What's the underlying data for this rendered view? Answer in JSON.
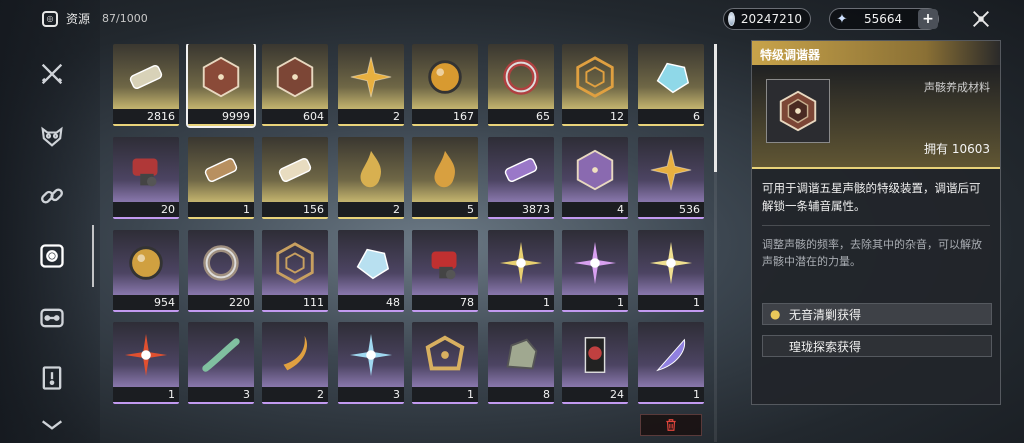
{
  "header": {
    "resource_label": "资源",
    "resource_count": "87/1000",
    "currency1": "20247210",
    "currency2": "55664",
    "add_label": "+"
  },
  "nav": [
    "sword-icon",
    "echo-mask-icon",
    "link-icon",
    "resource-icon",
    "device-icon",
    "quest-icon",
    "chevron-icon"
  ],
  "items": [
    {
      "qty": "2816",
      "rarity": "gold",
      "icon": "canister-icon",
      "color": "#d8d2b8"
    },
    {
      "qty": "9999",
      "rarity": "gold",
      "icon": "tuner-core-icon",
      "color": "#8a4a38"
    },
    {
      "qty": "604",
      "rarity": "gold",
      "icon": "tuner-core-icon",
      "color": "#7c4636"
    },
    {
      "qty": "2",
      "rarity": "gold",
      "icon": "golden-star-icon",
      "color": "#e8b040"
    },
    {
      "qty": "167",
      "rarity": "gold",
      "icon": "golden-orb-icon",
      "color": "#d89a30"
    },
    {
      "qty": "65",
      "rarity": "gold",
      "icon": "ring-icon",
      "color": "#b04040"
    },
    {
      "qty": "12",
      "rarity": "gold",
      "icon": "golden-web-icon",
      "color": "#e0a040"
    },
    {
      "qty": "6",
      "rarity": "gold",
      "icon": "crystal-shell-icon",
      "color": "#8fd8e8"
    },
    {
      "qty": "20",
      "rarity": "purple",
      "icon": "mech-part-icon",
      "color": "#b03838"
    },
    {
      "qty": "1",
      "rarity": "gold",
      "icon": "scroll-canister-icon",
      "color": "#b89060"
    },
    {
      "qty": "156",
      "rarity": "gold",
      "icon": "bullet-icon",
      "color": "#e8dcc0"
    },
    {
      "qty": "2",
      "rarity": "gold",
      "icon": "wave-shard-icon",
      "color": "#d8b050"
    },
    {
      "qty": "5",
      "rarity": "gold",
      "icon": "flame-shard-icon",
      "color": "#d8a040"
    },
    {
      "qty": "3873",
      "rarity": "purple",
      "icon": "purple-canister-icon",
      "color": "#9a78c8"
    },
    {
      "qty": "4",
      "rarity": "purple",
      "icon": "purple-core-icon",
      "color": "#8a6ab0"
    },
    {
      "qty": "536",
      "rarity": "purple",
      "icon": "golden-star-icon",
      "color": "#e8b040"
    },
    {
      "qty": "954",
      "rarity": "purple",
      "icon": "dark-orb-icon",
      "color": "#d0a040"
    },
    {
      "qty": "220",
      "rarity": "purple",
      "icon": "ring-icon",
      "color": "#a09080"
    },
    {
      "qty": "111",
      "rarity": "purple",
      "icon": "golden-web-icon",
      "color": "#c8a060"
    },
    {
      "qty": "48",
      "rarity": "purple",
      "icon": "crystal-icon",
      "color": "#b8e0f0"
    },
    {
      "qty": "78",
      "rarity": "purple",
      "icon": "mech-part-icon",
      "color": "#c03030"
    },
    {
      "qty": "1",
      "rarity": "purple",
      "icon": "spark-icon",
      "color": "#e8d070"
    },
    {
      "qty": "1",
      "rarity": "purple",
      "icon": "violet-spark-icon",
      "color": "#d8a0f0"
    },
    {
      "qty": "1",
      "rarity": "purple",
      "icon": "spark-icon",
      "color": "#f0e090"
    },
    {
      "qty": "1",
      "rarity": "purple",
      "icon": "fire-spark-icon",
      "color": "#e05030"
    },
    {
      "qty": "3",
      "rarity": "purple",
      "icon": "vine-icon",
      "color": "#80c0a0"
    },
    {
      "qty": "2",
      "rarity": "purple",
      "icon": "crescent-icon",
      "color": "#e0a040"
    },
    {
      "qty": "3",
      "rarity": "purple",
      "icon": "ice-spark-icon",
      "color": "#a0d8f0"
    },
    {
      "qty": "1",
      "rarity": "purple",
      "icon": "amber-frame-icon",
      "color": "#d8b060"
    },
    {
      "qty": "8",
      "rarity": "purple",
      "icon": "mossy-stone-icon",
      "color": "#a0a890"
    },
    {
      "qty": "24",
      "rarity": "purple",
      "icon": "banner-icon",
      "color": "#c04040"
    },
    {
      "qty": "1",
      "rarity": "purple",
      "icon": "feather-icon",
      "color": "#9080e0"
    }
  ],
  "panel": {
    "title": "特级调谐器",
    "category": "声骸养成材料",
    "owned": "拥有 10603",
    "description": "可用于调谐五星声骸的特级装置，调谐后可解锁一条辅音属性。",
    "lore": "调整声骸的频率，去除其中的杂音，可以解放声骸中潜在的力量。",
    "sources": [
      "无音清剿获得",
      "瑝珑探索获得"
    ]
  },
  "colors": {
    "gold": "#e9d37a",
    "purple": "#c29af0",
    "delete": "#e2463c"
  }
}
